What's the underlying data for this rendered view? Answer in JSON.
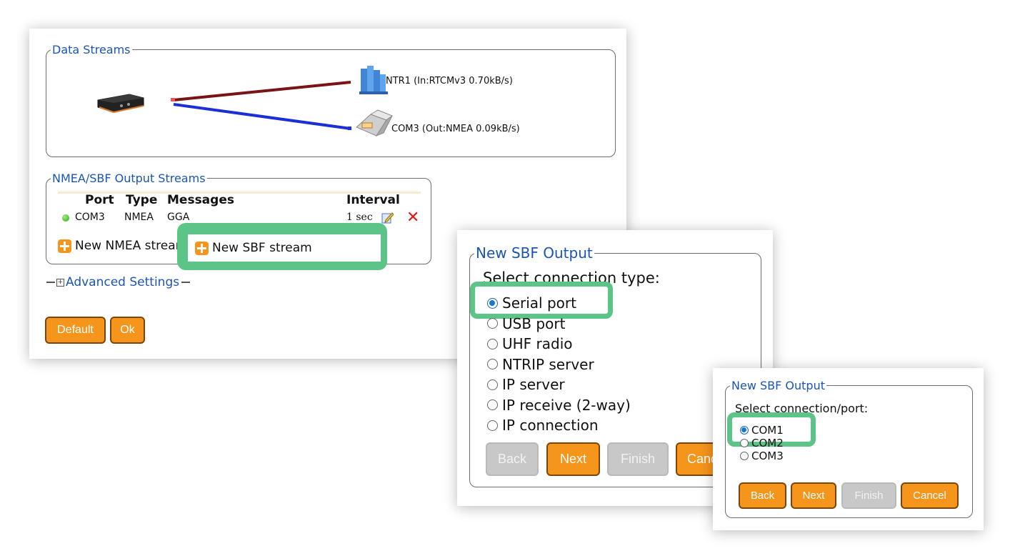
{
  "main": {
    "data_streams": {
      "legend": "Data Streams",
      "ntrip_label": "NTR1 (In:RTCMv3 0.70kB/s)",
      "com_label": "COM3 (Out:NMEA 0.09kB/s)"
    },
    "output_streams": {
      "legend": "NMEA/SBF Output Streams",
      "headers": {
        "port": "Port",
        "type": "Type",
        "messages": "Messages",
        "interval": "Interval"
      },
      "rows": [
        {
          "status": "active",
          "port": "COM3",
          "type": "NMEA",
          "messages": "GGA",
          "interval": "1 sec"
        }
      ],
      "new_nmea": "New NMEA stream",
      "new_sbf": "New SBF stream"
    },
    "advanced": {
      "label": "Advanced Settings"
    },
    "buttons": {
      "default": "Default",
      "ok": "Ok"
    }
  },
  "wizard1": {
    "legend": "New SBF Output",
    "prompt": "Select connection type:",
    "options": [
      "Serial port",
      "USB port",
      "UHF radio",
      "NTRIP server",
      "IP server",
      "IP receive (2-way)",
      "IP connection"
    ],
    "selected": "Serial port",
    "buttons": {
      "back": "Back",
      "next": "Next",
      "finish": "Finish",
      "cancel": "Cancel"
    }
  },
  "wizard2": {
    "legend": "New SBF Output",
    "prompt": "Select connection/port:",
    "options": [
      "COM1",
      "COM2",
      "COM3"
    ],
    "selected": "COM1",
    "buttons": {
      "back": "Back",
      "next": "Next",
      "finish": "Finish",
      "cancel": "Cancel"
    }
  },
  "colors": {
    "accent_orange": "#f6951c",
    "legend_blue": "#1a55b5",
    "highlight_green": "#5cc486",
    "link_in": "#7a1414",
    "link_out": "#1b2fd6"
  }
}
